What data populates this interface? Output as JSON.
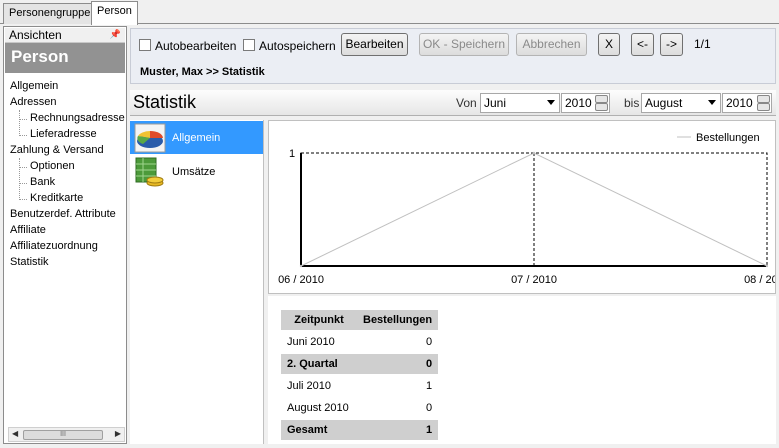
{
  "tabs": [
    {
      "label": "Personengruppe",
      "active": false
    },
    {
      "label": "Person",
      "active": true
    }
  ],
  "left_panel": {
    "header": "Ansichten",
    "pin_icon": "pin-icon",
    "title": "Person",
    "nav_items": [
      {
        "label": "Allgemein",
        "level": 0
      },
      {
        "label": "Adressen",
        "level": 0
      },
      {
        "label": "Rechnungsadresse",
        "level": 1
      },
      {
        "label": "Lieferadresse",
        "level": 1
      },
      {
        "label": "Zahlung & Versand",
        "level": 0
      },
      {
        "label": "Optionen",
        "level": 1
      },
      {
        "label": "Bank",
        "level": 1
      },
      {
        "label": "Kreditkarte",
        "level": 1
      },
      {
        "label": "Benutzerdef. Attribute",
        "level": 0
      },
      {
        "label": "Affiliate",
        "level": 0
      },
      {
        "label": "Affiliatezuordnung",
        "level": 0
      },
      {
        "label": "Statistik",
        "level": 0
      }
    ],
    "scrollbar_thumb_label": "III"
  },
  "toolbar": {
    "autobearbeiten_label": "Autobearbeiten",
    "autobearbeiten_checked": false,
    "autospeichern_label": "Autospeichern",
    "autospeichern_checked": false,
    "bearbeiten_label": "Bearbeiten",
    "ok_speichern_label": "OK - Speichern",
    "abbrechen_label": "Abbrechen",
    "close_label": "X",
    "prev_label": "<-",
    "next_label": "->",
    "counter": "1/1",
    "breadcrumb": "Muster, Max >> Statistik"
  },
  "statistik": {
    "title": "Statistik",
    "von_label": "Von",
    "von_month": "Juni",
    "von_year": "2010",
    "bis_label": "bis",
    "bis_month": "August",
    "bis_year": "2010"
  },
  "stat_list": [
    {
      "label": "Allgemein",
      "icon": "pie-chart-icon",
      "selected": true
    },
    {
      "label": "Umsätze",
      "icon": "sales-chart-icon",
      "selected": false
    }
  ],
  "chart_data": {
    "type": "line",
    "title": "",
    "xlabel": "",
    "ylabel": "",
    "x": [
      "06 / 2010",
      "07 / 2010",
      "08 / 2010"
    ],
    "series": [
      {
        "name": "Bestellungen",
        "values": [
          0,
          1,
          0
        ],
        "color": "#c0c0c0"
      }
    ],
    "ylim": [
      0,
      1
    ],
    "y_ticks": [
      1
    ],
    "legend": "top-right"
  },
  "table": {
    "headers": [
      "Zeitpunkt",
      "Bestellungen"
    ],
    "rows": [
      {
        "cells": [
          "Juni 2010",
          "0"
        ],
        "shaded": false
      },
      {
        "cells": [
          "2. Quartal",
          "0"
        ],
        "shaded": true
      },
      {
        "cells": [
          "Juli 2010",
          "1"
        ],
        "shaded": false
      },
      {
        "cells": [
          "August 2010",
          "0"
        ],
        "shaded": false
      },
      {
        "cells": [
          "Gesamt",
          "1"
        ],
        "shaded": true
      }
    ]
  }
}
